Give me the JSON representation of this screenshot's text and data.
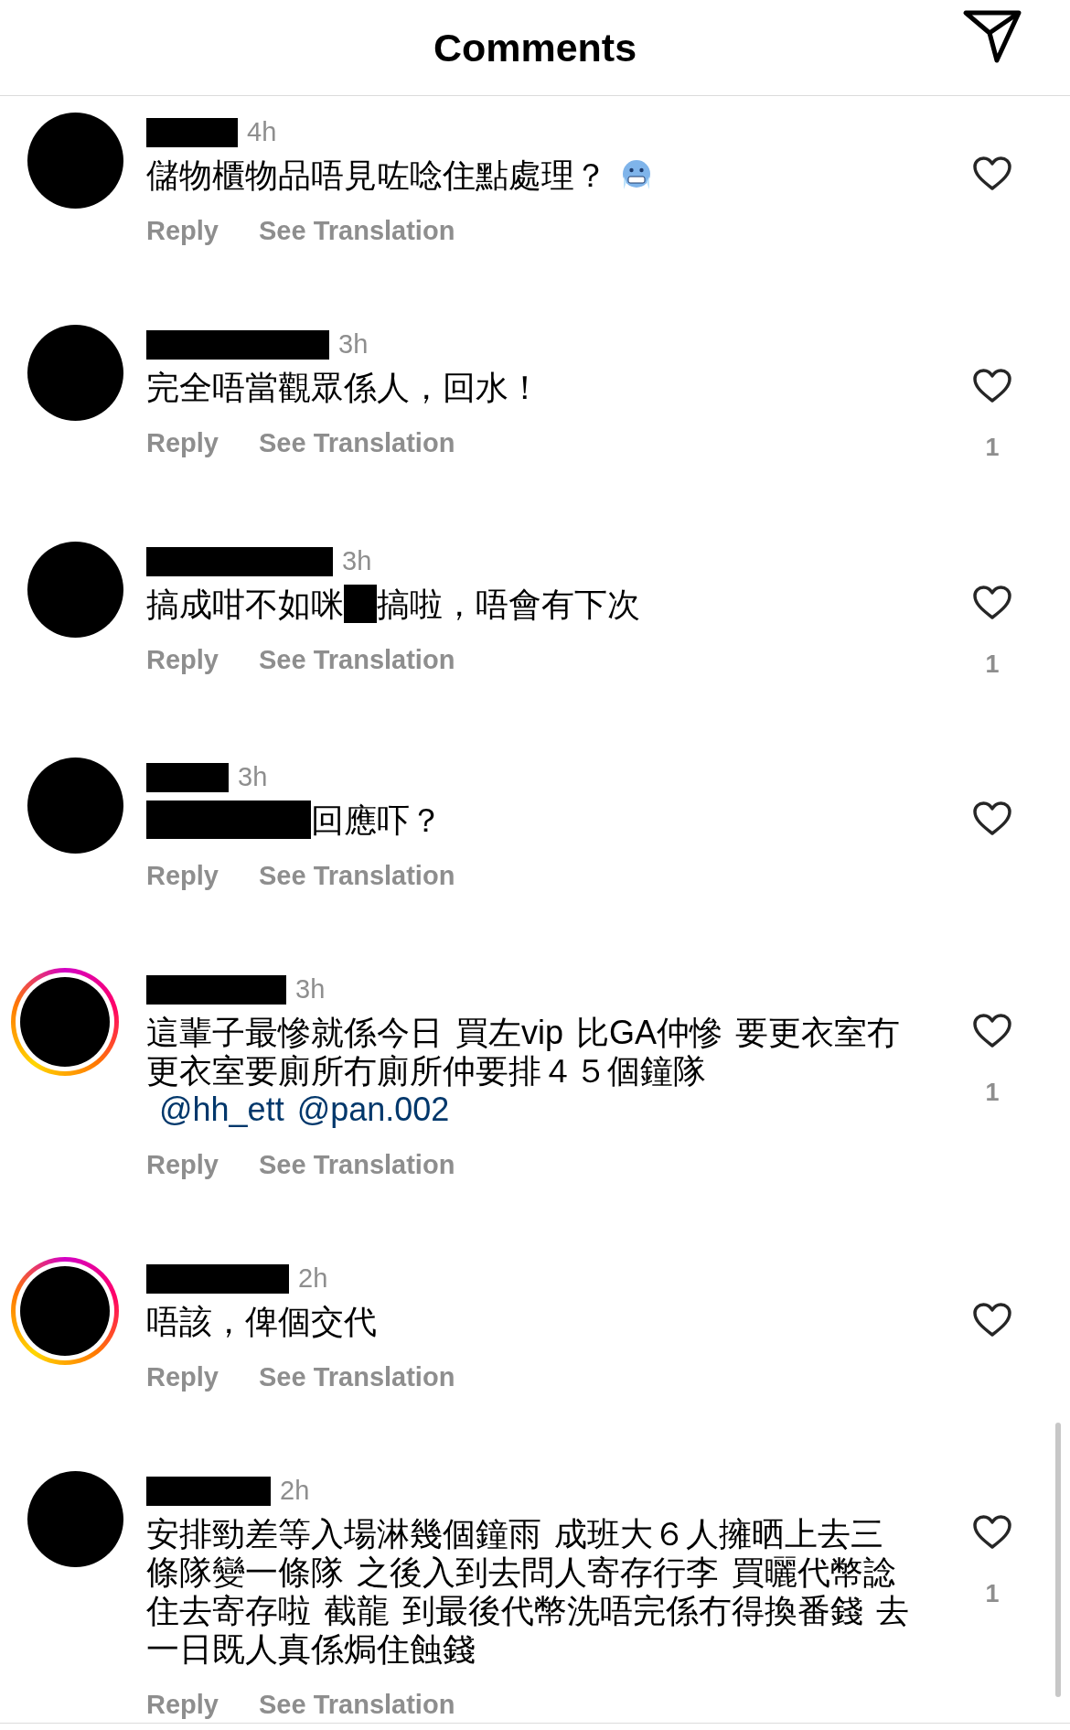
{
  "header": {
    "title": "Comments"
  },
  "comments": [
    {
      "username_redacted": true,
      "story_ring": false,
      "time": "4h",
      "text": [
        {
          "kind": "text",
          "text": "儲物櫃物品唔見咗唸住點處理？"
        },
        {
          "kind": "emoji"
        }
      ],
      "liked": false,
      "reply": "Reply",
      "translate": "See Translation"
    },
    {
      "username_redacted": true,
      "story_ring": false,
      "time": "3h",
      "text": [
        {
          "kind": "text",
          "text": "完全唔當觀眾係人，回水！"
        }
      ],
      "liked": false,
      "likes": "1",
      "reply": "Reply",
      "translate": "See Translation"
    },
    {
      "username_redacted": true,
      "story_ring": false,
      "time": "3h",
      "text": [
        {
          "kind": "text",
          "text": "搞成咁不如咪"
        },
        {
          "kind": "redaction"
        },
        {
          "kind": "text",
          "text": "搞啦，唔會有下次"
        }
      ],
      "liked": false,
      "likes": "1",
      "reply": "Reply",
      "translate": "See Translation"
    },
    {
      "username_redacted": true,
      "story_ring": false,
      "time": "3h",
      "text": [
        {
          "kind": "redaction"
        },
        {
          "kind": "text",
          "text": "回應吓？"
        }
      ],
      "liked": false,
      "reply": "Reply",
      "translate": "See Translation"
    },
    {
      "username_redacted": true,
      "story_ring": true,
      "time": "3h",
      "text": [
        {
          "kind": "text",
          "text": "這輩子最慘就係今日 買左vip 比GA仲慘 要更衣室冇更衣室要廁所冇廁所仲要排４５個鐘隊"
        },
        {
          "kind": "mention",
          "text": "@hh_ett"
        },
        {
          "kind": "mention",
          "text": "@pan.002"
        }
      ],
      "liked": false,
      "likes": "1",
      "reply": "Reply",
      "translate": "See Translation"
    },
    {
      "username_redacted": true,
      "story_ring": true,
      "time": "2h",
      "text": [
        {
          "kind": "text",
          "text": "唔該，俾個交代"
        }
      ],
      "liked": false,
      "reply": "Reply",
      "translate": "See Translation"
    },
    {
      "username_redacted": true,
      "story_ring": false,
      "time": "2h",
      "text": [
        {
          "kind": "text",
          "text": "安排勁差等入場淋幾個鐘雨 成班大６人擁晒上去三條隊變一條隊 之後入到去問人寄存行李 買曬代幣諗住去寄存啦 截龍 到最後代幣洗唔完係冇得換番錢 去一日既人真係焗住蝕錢"
        }
      ],
      "liked": false,
      "likes": "1",
      "reply": "Reply",
      "translate": "See Translation"
    }
  ]
}
